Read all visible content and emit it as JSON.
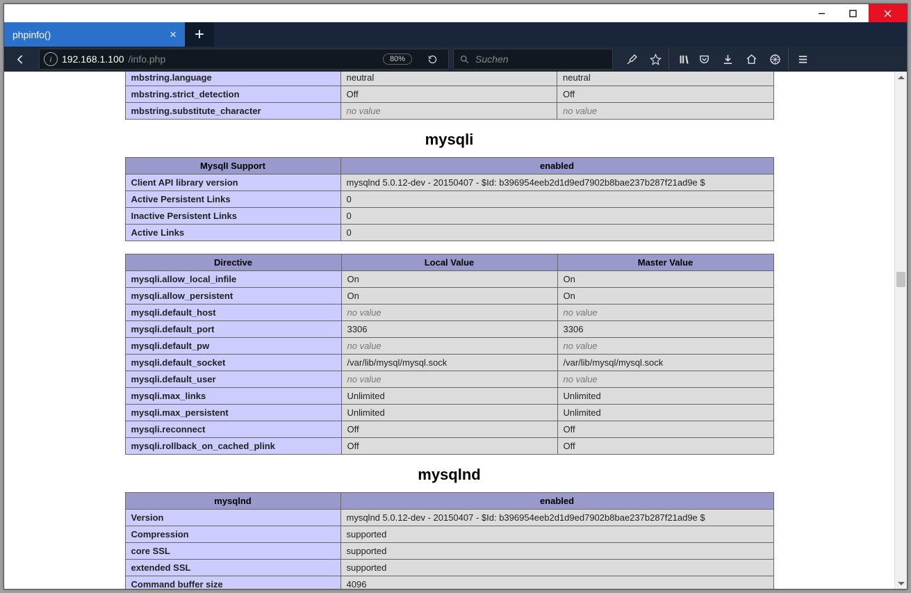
{
  "window": {
    "tab_title": "phpinfo()"
  },
  "url": {
    "host": "192.168.1.100",
    "path": "/info.php"
  },
  "zoom": "80%",
  "search_placeholder": "Suchen",
  "mbstring_rows": [
    {
      "name": "mbstring.language",
      "local": "neutral",
      "master": "neutral",
      "nv": false
    },
    {
      "name": "mbstring.strict_detection",
      "local": "Off",
      "master": "Off",
      "nv": false
    },
    {
      "name": "mbstring.substitute_character",
      "local": "no value",
      "master": "no value",
      "nv": true
    }
  ],
  "sections": {
    "mysqli": "mysqli",
    "mysqlnd": "mysqlnd"
  },
  "mysqli_support": {
    "header_left": "MysqlI Support",
    "header_right": "enabled",
    "rows": [
      {
        "name": "Client API library version",
        "value": "mysqlnd 5.0.12-dev - 20150407 - $Id: b396954eeb2d1d9ed7902b8bae237b287f21ad9e $"
      },
      {
        "name": "Active Persistent Links",
        "value": "0"
      },
      {
        "name": "Inactive Persistent Links",
        "value": "0"
      },
      {
        "name": "Active Links",
        "value": "0"
      }
    ]
  },
  "mysqli_directive": {
    "h1": "Directive",
    "h2": "Local Value",
    "h3": "Master Value",
    "rows": [
      {
        "name": "mysqli.allow_local_infile",
        "local": "On",
        "master": "On",
        "nv": false
      },
      {
        "name": "mysqli.allow_persistent",
        "local": "On",
        "master": "On",
        "nv": false
      },
      {
        "name": "mysqli.default_host",
        "local": "no value",
        "master": "no value",
        "nv": true
      },
      {
        "name": "mysqli.default_port",
        "local": "3306",
        "master": "3306",
        "nv": false
      },
      {
        "name": "mysqli.default_pw",
        "local": "no value",
        "master": "no value",
        "nv": true
      },
      {
        "name": "mysqli.default_socket",
        "local": "/var/lib/mysql/mysql.sock",
        "master": "/var/lib/mysql/mysql.sock",
        "nv": false
      },
      {
        "name": "mysqli.default_user",
        "local": "no value",
        "master": "no value",
        "nv": true
      },
      {
        "name": "mysqli.max_links",
        "local": "Unlimited",
        "master": "Unlimited",
        "nv": false
      },
      {
        "name": "mysqli.max_persistent",
        "local": "Unlimited",
        "master": "Unlimited",
        "nv": false
      },
      {
        "name": "mysqli.reconnect",
        "local": "Off",
        "master": "Off",
        "nv": false
      },
      {
        "name": "mysqli.rollback_on_cached_plink",
        "local": "Off",
        "master": "Off",
        "nv": false
      }
    ]
  },
  "mysqlnd_support": {
    "header_left": "mysqlnd",
    "header_right": "enabled",
    "rows": [
      {
        "name": "Version",
        "value": "mysqlnd 5.0.12-dev - 20150407 - $Id: b396954eeb2d1d9ed7902b8bae237b287f21ad9e $"
      },
      {
        "name": "Compression",
        "value": "supported"
      },
      {
        "name": "core SSL",
        "value": "supported"
      },
      {
        "name": "extended SSL",
        "value": "supported"
      },
      {
        "name": "Command buffer size",
        "value": "4096"
      }
    ]
  }
}
